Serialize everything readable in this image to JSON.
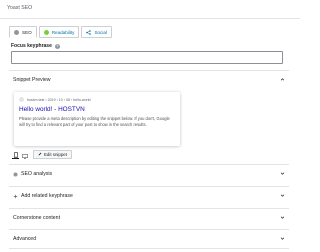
{
  "panel": {
    "title": "Yoast SEO"
  },
  "tabs": [
    {
      "label": "SEO",
      "color": "#8f98a1"
    },
    {
      "label": "Readability",
      "color": "#7ad03a"
    },
    {
      "label": "Social"
    }
  ],
  "focus_keyphrase": {
    "label": "Focus keyphrase",
    "help": "?",
    "value": ""
  },
  "snippet_preview": {
    "heading": "Snippet Preview",
    "breadcrumb": "hostvn.test › 2019 › 10 › 08 › hello-world",
    "seo_title": "Hello world! - HOSTVN",
    "meta_description": "Please provide a meta description by editing the snippet below. If you don't, Google will try to find a relevant part of your post to show in the search results.",
    "edit_label": "Edit snippet"
  },
  "sections": {
    "seo_analysis": "SEO analysis",
    "related_keyphrase": "Add related keyphrase",
    "cornerstone": "Cornerstone content",
    "advanced": "Advanced"
  },
  "colors": {
    "link_title": "#1a0dab",
    "accent": "#0073aa"
  }
}
